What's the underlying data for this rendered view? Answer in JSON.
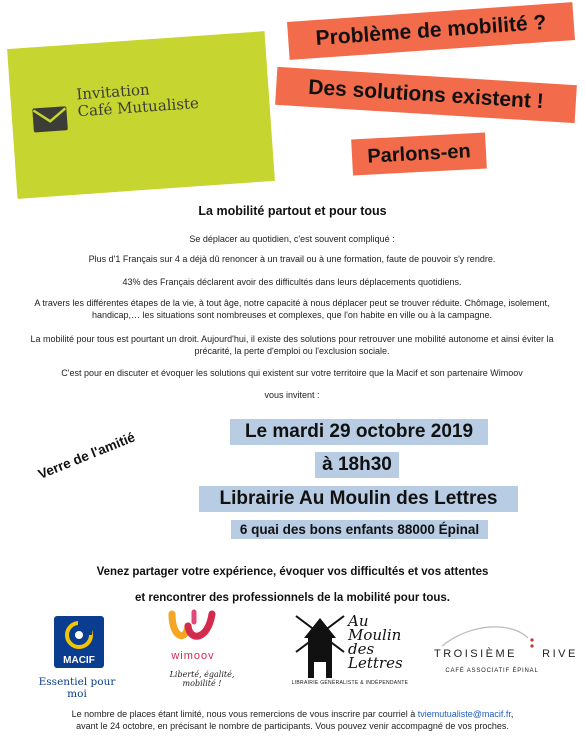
{
  "invitation_card": {
    "line1": "Invitation",
    "line2": "Café Mutualiste",
    "icon": "envelope-icon",
    "color": "#c7d530"
  },
  "headlines": {
    "line1": "Problème de mobilité ?",
    "line2": "Des solutions existent !",
    "line3": "Parlons-en",
    "color": "#f26b4a"
  },
  "body": {
    "title": "La mobilité partout et pour tous",
    "paragraphs": [
      "Se déplacer au quotidien, c'est souvent compliqué :",
      "Plus d'1 Français sur 4 a déjà dû renoncer à un travail ou à une formation, faute de pouvoir s'y rendre.",
      "43% des Français déclarent avoir des difficultés dans leurs déplacements quotidiens.",
      "A travers les différentes étapes de la vie, à tout âge, notre capacité à nous déplacer peut se trouver réduite. Chômage, isolement, handicap,… les situations sont nombreuses et complexes, que l'on habite en ville ou à la campagne.",
      "La mobilité pour tous est pourtant un droit. Aujourd'hui, il existe des solutions pour retrouver une mobilité autonome et ainsi éviter la précarité, la perte d'emploi ou l'exclusion sociale.",
      "C'est pour en discuter et évoquer les solutions qui existent sur votre territoire que la Macif et son partenaire Wimoov",
      "vous invitent :"
    ]
  },
  "event": {
    "date": "Le mardi 29 octobre 2019",
    "time": "à 18h30",
    "venue": "Librairie Au Moulin des Lettres",
    "address": "6 quai des bons enfants 88000 Épinal",
    "highlight_color": "#b8cce4",
    "aside": "Verre de l'amitié"
  },
  "invitation_lines": {
    "line1": "Venez partager votre expérience, évoquer vos difficultés et vos attentes",
    "line2": "et rencontrer des professionnels de la mobilité pour tous."
  },
  "logos": {
    "macif": {
      "name": "MACIF",
      "tagline": "Essentiel pour moi",
      "color": "#0a3d8f"
    },
    "wimoov": {
      "name": "wimoov",
      "tagline": "Liberté, égalité, mobilité !",
      "color": "#d42a4e"
    },
    "moulin": {
      "name_line1": "Au",
      "name_line2": "Moulin",
      "name_line3": "des",
      "name_line4": "Lettres",
      "subtitle": "LIBRAIRIE GÉNÉRALISTE & INDÉPENDANTE"
    },
    "troisieme_rive": {
      "name_left": "TROISIÈME",
      "name_right": "RIVE",
      "subtitle": "CAFÉ ASSOCIATIF ÉPINAL"
    }
  },
  "footer": {
    "text_before_email": "Le nombre de places étant limité, nous vous remercions de vous inscrire par courriel à ",
    "email": "tviemutualiste@macif.fr",
    "text_after_email": ",",
    "line2": "avant le 24 octobre, en précisant le nombre de participants. Vous pouvez venir accompagné de vos proches."
  }
}
